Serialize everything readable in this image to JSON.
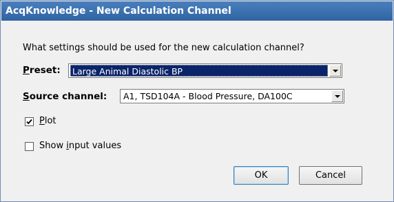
{
  "window": {
    "title": "AcqKnowledge - New Calculation Channel"
  },
  "dialog": {
    "prompt": "What settings should be used for the new calculation channel?",
    "preset": {
      "label_underlined": "P",
      "label_rest": "reset:",
      "value": "Large Animal Diastolic BP"
    },
    "source_channel": {
      "label_underlined": "S",
      "label_rest": "ource channel:",
      "value": "A1, TSD104A - Blood Pressure, DA100C"
    },
    "plot": {
      "label_underlined": "P",
      "label_rest": "lot",
      "checked": true
    },
    "show_input_values": {
      "label_prefix": "Show ",
      "label_underlined": "i",
      "label_rest": "nput values",
      "checked": false
    },
    "buttons": {
      "ok": "OK",
      "cancel": "Cancel"
    }
  }
}
